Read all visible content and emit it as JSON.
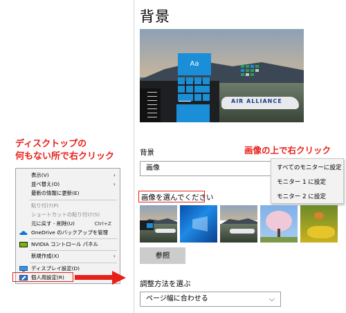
{
  "annotations": {
    "left_line1": "ディスクトップの",
    "left_line2": "何もない所で右クリック",
    "right": "画像の上で右クリック"
  },
  "context_menu": {
    "items": [
      {
        "label": "表示(V)",
        "arrow": "›",
        "disabled": false
      },
      {
        "label": "並べ替え(O)",
        "arrow": "›",
        "disabled": false
      },
      {
        "label": "最新の情報に更新(E)",
        "disabled": false
      },
      {
        "label": "貼り付け(P)",
        "disabled": true
      },
      {
        "label": "ショートカットの貼り付け(S)",
        "disabled": true
      },
      {
        "label": "元に戻す - 削除(U)",
        "shortcut": "Ctrl+Z",
        "disabled": false
      },
      {
        "label": "OneDrive のバックアップを管理",
        "icon": "onedrive-icon",
        "disabled": false
      },
      {
        "label": "NVIDIA コントロール パネル",
        "icon": "nvidia-icon",
        "disabled": false
      },
      {
        "label": "新規作成(X)",
        "arrow": "›",
        "disabled": false
      },
      {
        "label": "ディスプレイ設定(D)",
        "icon": "display-icon",
        "disabled": false
      },
      {
        "label": "個人用設定(R)",
        "icon": "personalize-icon",
        "disabled": false
      }
    ]
  },
  "settings": {
    "title": "背景",
    "preview_tile": "Aa",
    "preview_livery": "AIR ALLIANCE",
    "background_label": "背景",
    "background_value": "画像",
    "choose_image_label": "画像を選んでください",
    "browse_button": "参照",
    "fit_label": "調整方法を選ぶ",
    "fit_value": "ページ幅に合わせる"
  },
  "popup_menu": {
    "items": [
      "すべてのモニターに設定",
      "モニター 1 に設定",
      "モニター 2 に設定"
    ]
  },
  "colors": {
    "accent_red": "#e8201a",
    "tile_blue": "#1a8fd8"
  }
}
